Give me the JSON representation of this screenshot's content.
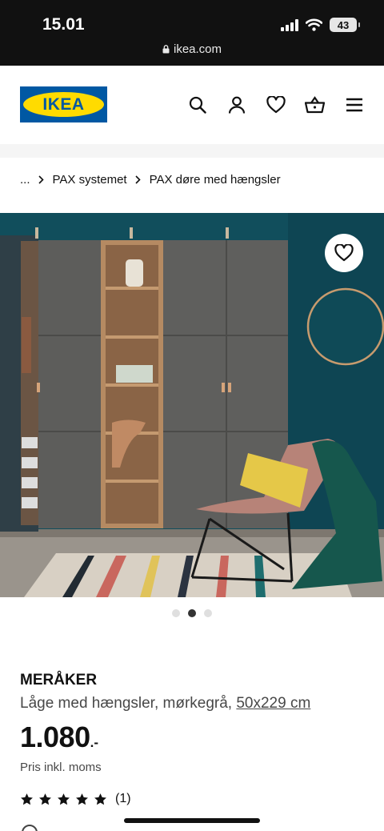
{
  "status_bar": {
    "time": "15.01",
    "battery": "43",
    "url": "ikea.com"
  },
  "header": {
    "logo_text": "IKEA",
    "icons": [
      "search-icon",
      "profile-icon",
      "heart-icon",
      "basket-icon",
      "menu-icon"
    ],
    "brand_colors": {
      "blue": "#0058a3",
      "yellow": "#ffdb00"
    }
  },
  "breadcrumb": {
    "ellipsis": "...",
    "items": [
      "PAX systemet",
      "PAX døre med hængsler"
    ]
  },
  "gallery": {
    "slide_count": 3,
    "active_slide": 2
  },
  "product": {
    "name": "MERÅKER",
    "description": "Låge med hængsler, mørkegrå, ",
    "size": "50x229 cm",
    "price": "1.080",
    "price_suffix": ".-",
    "price_note": "Pris inkl. moms",
    "rating_stars": 5,
    "rating_count": "(1)"
  }
}
